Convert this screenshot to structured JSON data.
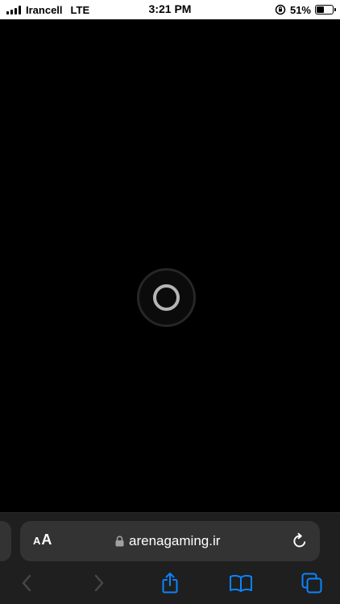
{
  "status_bar": {
    "carrier": "Irancell",
    "network": "LTE",
    "time": "3:21 PM",
    "battery_percent_text": "51%",
    "battery_level": 0.51,
    "signal_icon": "cellular-signal-icon",
    "orientation_lock_icon": "orientation-lock-icon",
    "battery_icon": "battery-icon"
  },
  "page": {
    "loading_icon": "loading-spinner-icon"
  },
  "browser": {
    "text_size_small": "A",
    "text_size_large": "A",
    "url": "arenagaming.ir",
    "lock_icon": "lock-icon",
    "reload_icon": "reload-icon",
    "toolbar": {
      "back_icon": "chevron-left-icon",
      "forward_icon": "chevron-right-icon",
      "share_icon": "share-icon",
      "bookmarks_icon": "book-icon",
      "tabs_icon": "tabs-icon"
    }
  },
  "colors": {
    "accent": "#0a84ff",
    "disabled": "#48484a",
    "chrome_bg": "#1f1f1f",
    "address_bar_bg": "#333334"
  }
}
